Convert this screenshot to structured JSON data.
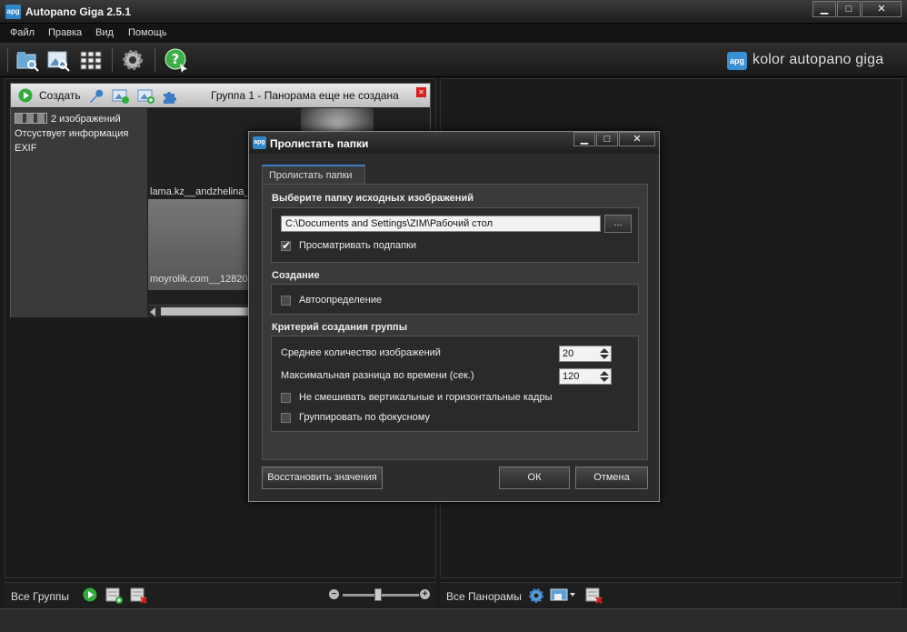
{
  "window": {
    "title": "Autopano Giga 2.5.1",
    "logo_text": "apg",
    "minimize": "▁",
    "maximize": "□",
    "close": "✕"
  },
  "menu": [
    "Файл",
    "Правка",
    "Вид",
    "Помощь"
  ],
  "toolbar": {
    "brand": "kolor autopano giga",
    "brand_logo": "apg"
  },
  "group": {
    "create_label": "Создать",
    "title": "Группа 1 - Панорама еще не создана",
    "image_count": "2 изображений",
    "exif_line1": "Отсуствует информация",
    "exif_line2": "EXIF",
    "thumb1": "lama.kz__andzhelina_d",
    "thumb2": "moyrolik.com__128207"
  },
  "left_footer": {
    "label": "Все Группы"
  },
  "right_footer": {
    "label": "Все Панорамы"
  },
  "dialog": {
    "title": "Пролистать папки",
    "logo_text": "apg",
    "tab": "Пролистать папки",
    "section_source": "Выберите папку исходных изображений",
    "path": "C:\\Documents and Settings\\ZIM\\Рабочий стол",
    "browse": "...",
    "scan_subfolders": "Просматривать подпапки",
    "scan_subfolders_checked": true,
    "section_create": "Создание",
    "autodetect": "Автоопределение",
    "autodetect_checked": false,
    "section_criteria": "Критерий создания группы",
    "avg_images_label": "Среднее количество изображений",
    "avg_images_value": "20",
    "max_time_label": "Максимальная разница во времени (сек.)",
    "max_time_value": "120",
    "no_mix": "Не смешивать вертикальные и горизонтальные кадры",
    "no_mix_checked": false,
    "group_focal": "Группировать по фокусному",
    "group_focal_checked": false,
    "restore_btn": "Восстановить значения",
    "ok_btn": "ОК",
    "cancel_btn": "Отмена"
  },
  "colors": {
    "accent": "#2f86c9",
    "close_red": "#d62020",
    "play_green": "#2fae3a"
  }
}
